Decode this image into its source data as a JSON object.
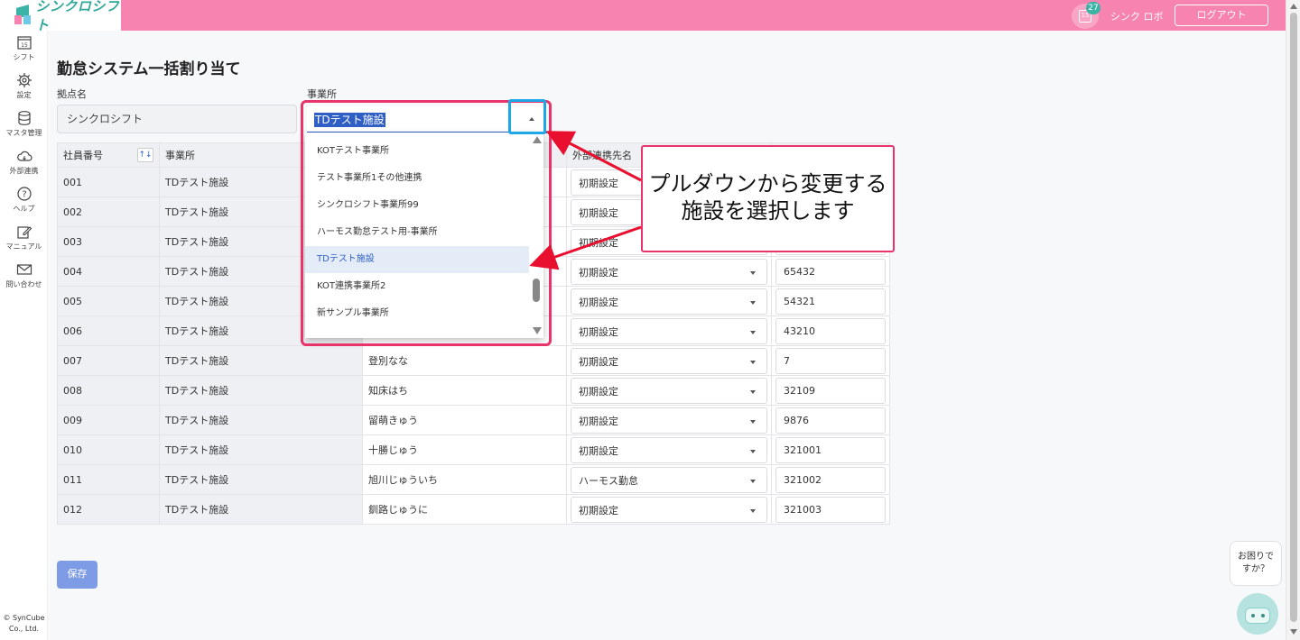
{
  "header": {
    "logo_text": "シンクロシフト",
    "calendar_day": "15",
    "notification_count": "27",
    "user_name": "シンク ロボ",
    "logout_label": "ログアウト"
  },
  "sidebar": {
    "items": [
      {
        "label": "シフト",
        "icon": "calendar-icon"
      },
      {
        "label": "設定",
        "icon": "gear-icon"
      },
      {
        "label": "マスタ管理",
        "icon": "database-icon"
      },
      {
        "label": "外部連携",
        "icon": "cloud-icon"
      },
      {
        "label": "ヘルプ",
        "icon": "help-icon"
      },
      {
        "label": "マニュアル",
        "icon": "edit-icon"
      },
      {
        "label": "問い合わせ",
        "icon": "mail-icon"
      }
    ],
    "calendar_day": "15",
    "copyright_line1": "© SynCube",
    "copyright_line2": "Co., Ltd."
  },
  "page": {
    "title": "勤怠システム一括割り当て",
    "base_label": "拠点名",
    "base_value": "シンクロシフト",
    "office_label": "事業所",
    "office_value": "TDテスト施設",
    "save_label": "保存"
  },
  "table": {
    "headers": [
      "社員番号",
      "事業所",
      "",
      "外部連携先名",
      ""
    ],
    "sort_icon": "↑↓",
    "rows": [
      {
        "id": "001",
        "office": "TDテスト施設",
        "name": "",
        "system": "初期設定",
        "code": ""
      },
      {
        "id": "002",
        "office": "TDテスト施設",
        "name": "",
        "system": "初期設定",
        "code": ""
      },
      {
        "id": "003",
        "office": "TDテスト施設",
        "name": "",
        "system": "初期設定",
        "code": ""
      },
      {
        "id": "004",
        "office": "TDテスト施設",
        "name": "",
        "system": "初期設定",
        "code": "65432"
      },
      {
        "id": "005",
        "office": "TDテスト施設",
        "name": "",
        "system": "初期設定",
        "code": "54321"
      },
      {
        "id": "006",
        "office": "TDテスト施設",
        "name": "",
        "system": "初期設定",
        "code": "43210"
      },
      {
        "id": "007",
        "office": "TDテスト施設",
        "name": "登別なな",
        "system": "初期設定",
        "code": "7"
      },
      {
        "id": "008",
        "office": "TDテスト施設",
        "name": "知床はち",
        "system": "初期設定",
        "code": "32109"
      },
      {
        "id": "009",
        "office": "TDテスト施設",
        "name": "留萌きゅう",
        "system": "初期設定",
        "code": "9876"
      },
      {
        "id": "010",
        "office": "TDテスト施設",
        "name": "十勝じゅう",
        "system": "初期設定",
        "code": "321001"
      },
      {
        "id": "011",
        "office": "TDテスト施設",
        "name": "旭川じゅういち",
        "system": "ハーモス勤怠",
        "code": "321002"
      },
      {
        "id": "012",
        "office": "TDテスト施設",
        "name": "釧路じゅうに",
        "system": "初期設定",
        "code": "321003"
      }
    ]
  },
  "dropdown": {
    "options": [
      "KOTテスト事業所",
      "テスト事業所1その他連携",
      "シンクロシフト事業所99",
      "ハーモス勤怠テスト用-事業所",
      "TDテスト施設",
      "KOT連携事業所2",
      "新サンプル事業所"
    ],
    "selected": "TDテスト施設"
  },
  "annotation": {
    "line1": "プルダウンから変更する",
    "line2": "施設を選択します",
    "color": "#e8336b",
    "highlight_color": "#1ea7e6"
  },
  "help_widget": {
    "line1": "お困りで",
    "line2": "すか？"
  }
}
